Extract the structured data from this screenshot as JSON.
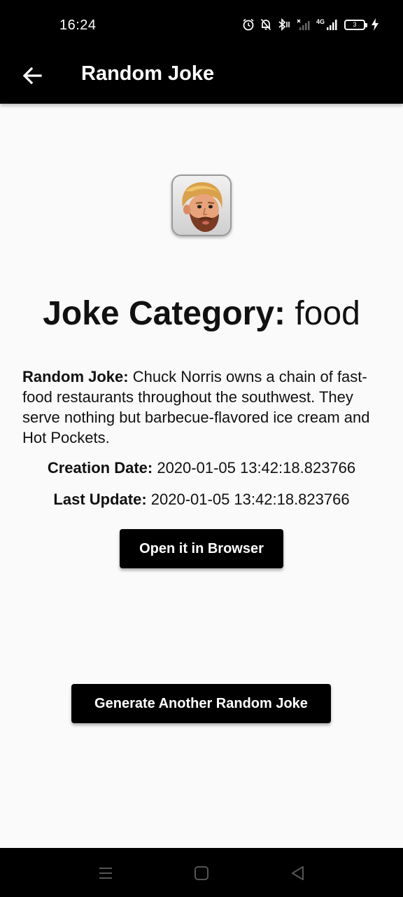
{
  "status_bar": {
    "time": "16:24",
    "network_label": "4G",
    "battery_level": "3"
  },
  "app_bar": {
    "title": "Random Joke"
  },
  "joke": {
    "category_label": "Joke Category:",
    "category_value": "food",
    "joke_label": "Random Joke:",
    "joke_value": "Chuck Norris owns a chain of fast-food restaurants throughout the southwest. They serve nothing but barbecue-flavored ice cream and Hot Pockets.",
    "creation_label": "Creation Date:",
    "creation_value": "2020-01-05 13:42:18.823766",
    "update_label": "Last Update:",
    "update_value": "2020-01-05 13:42:18.823766"
  },
  "buttons": {
    "open_browser": "Open it in Browser",
    "generate": "Generate Another Random Joke"
  },
  "colors": {
    "bar_background": "#000000",
    "page_background": "#fafafa",
    "button_background": "#000000",
    "button_text": "#ffffff"
  },
  "icons": {
    "back": "arrow-back-icon",
    "avatar": "chuck-norris-avatar-icon",
    "nav_menu": "menu-icon",
    "nav_home": "home-icon",
    "nav_back": "back-triangle-icon"
  }
}
